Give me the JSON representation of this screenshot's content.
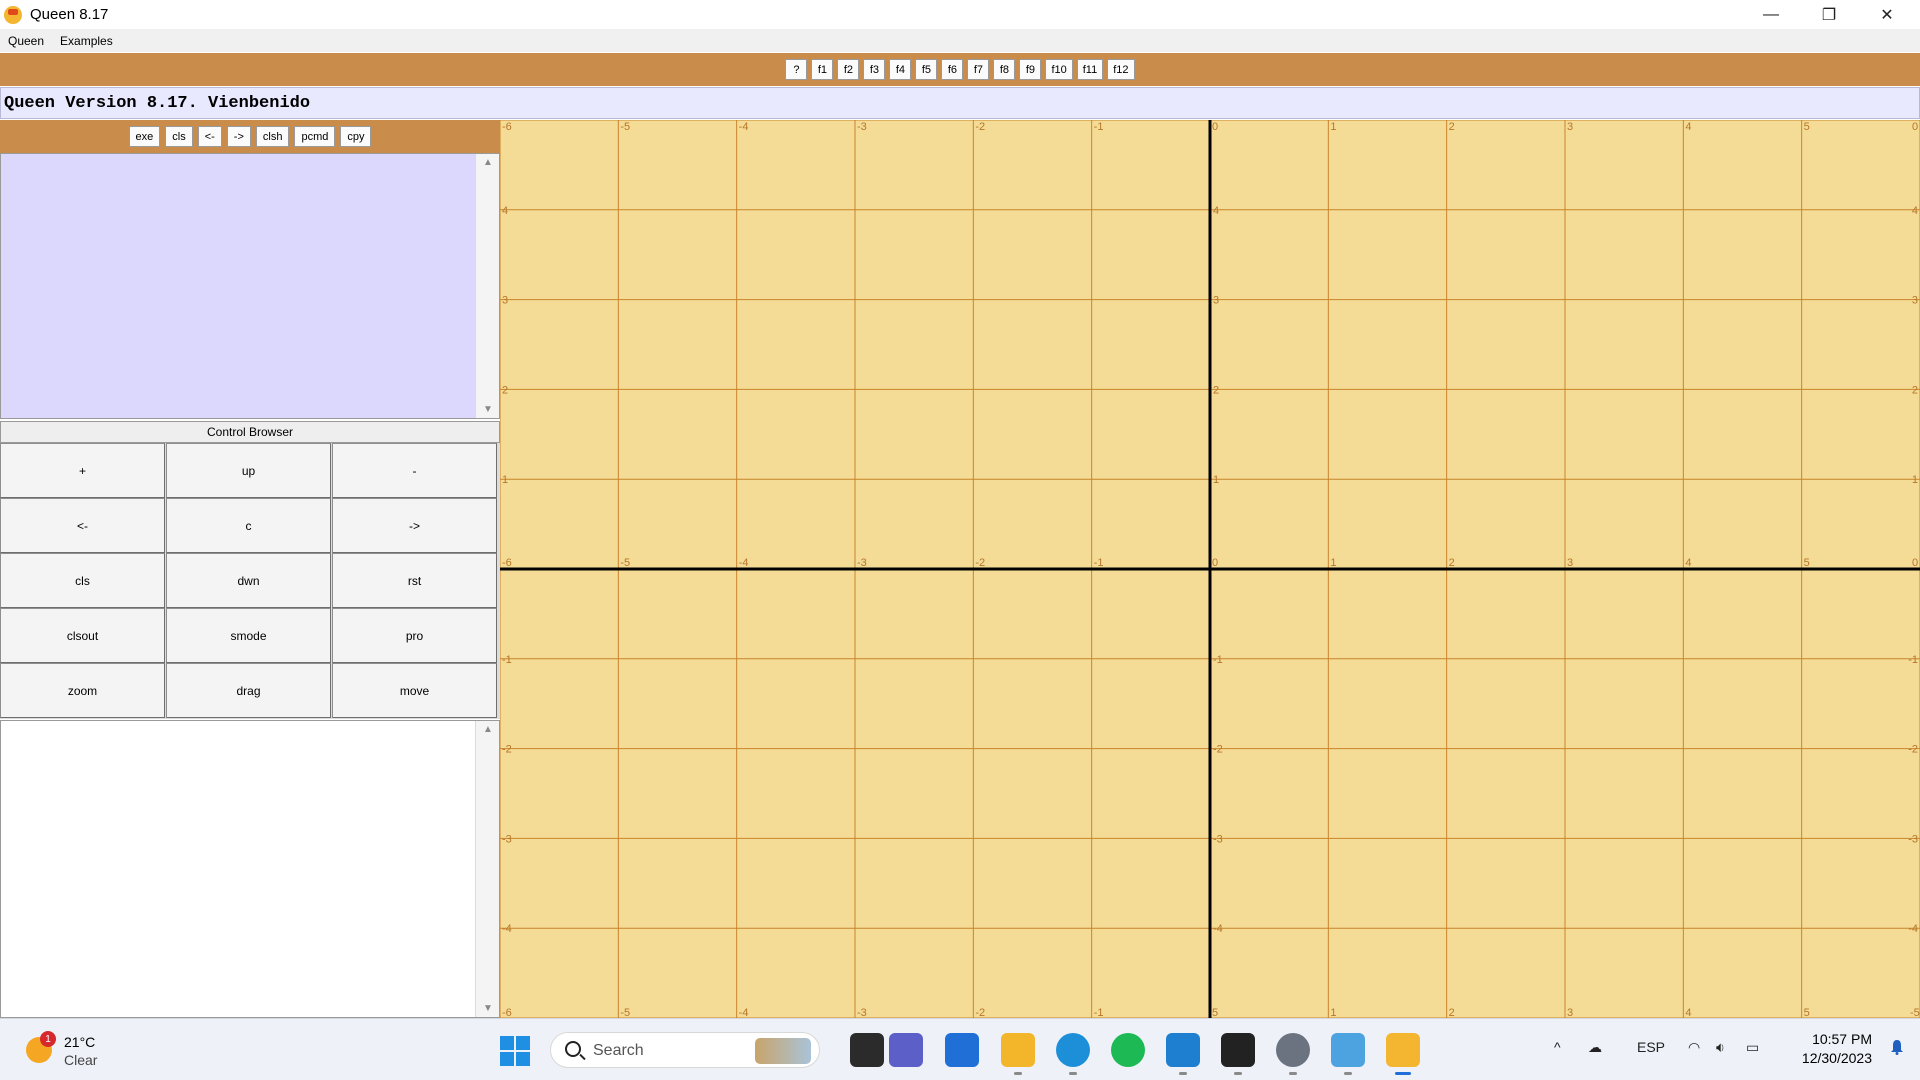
{
  "window": {
    "title": "Queen  8.17",
    "minimize": "—",
    "maximize": "❐",
    "close": "✕"
  },
  "menu": [
    "Queen",
    "Examples"
  ],
  "fkeys": [
    "?",
    "f1",
    "f2",
    "f3",
    "f4",
    "f5",
    "f6",
    "f7",
    "f8",
    "f9",
    "f10",
    "f11",
    "f12"
  ],
  "version_text": "Queen Version 8.17. Vienbenido",
  "cmd_buttons": [
    "exe",
    "cls",
    "<-",
    "->",
    "clsh",
    "pcmd",
    "cpy"
  ],
  "control_browser": {
    "title": "Control Browser",
    "buttons": [
      "+",
      "up",
      "-",
      "<-",
      "c",
      "->",
      "cls",
      "dwn",
      "rst",
      "clsout",
      "smode",
      "pro",
      "zoom",
      "drag",
      "move"
    ]
  },
  "plot": {
    "x_min": -6,
    "x_max": 6,
    "y_min": -5,
    "y_max": 5,
    "background": "#f5dc96",
    "grid_color": "#c8842a",
    "axis_color": "#000000",
    "label_color": "#b5762a",
    "x_ticks": [
      "-6",
      "-5",
      "-4",
      "-3",
      "-2",
      "-1",
      "0",
      "1",
      "2",
      "3",
      "4",
      "5",
      "0"
    ],
    "y_ticks": [
      "4",
      "3",
      "2",
      "1",
      "-1",
      "-2",
      "-3",
      "-4"
    ],
    "bottom_edge_ticks": [
      "-6",
      "-5",
      "-4",
      "-3",
      "-2",
      "-1",
      "5",
      "1",
      "2",
      "3",
      "4",
      "5",
      "-5"
    ]
  },
  "taskbar": {
    "weather_badge": "1",
    "temperature": "21°C",
    "condition": "Clear",
    "search_placeholder": "Search",
    "apps": [
      "task-view",
      "meet",
      "store",
      "file-explorer",
      "edge",
      "spotify",
      "vscode",
      "figma",
      "settings",
      "snipping-tool",
      "queen"
    ],
    "tray_chevron": "^",
    "language": "ESP",
    "time": "10:57 PM",
    "date": "12/30/2023"
  }
}
